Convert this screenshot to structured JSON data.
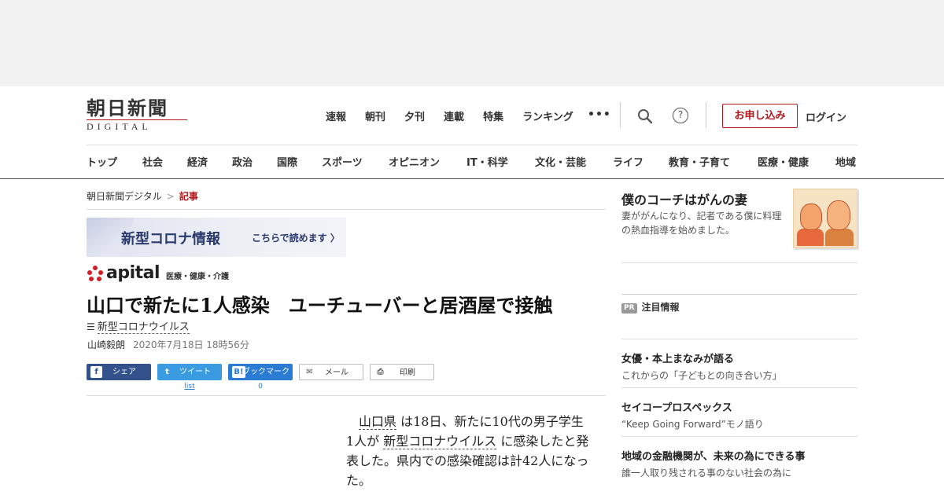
{
  "header": {
    "logo_main": "朝日新聞",
    "logo_sub": "DIGITAL",
    "top_nav": [
      "速報",
      "朝刊",
      "夕刊",
      "連載",
      "特集",
      "ランキング"
    ],
    "more": "•••",
    "help": "?",
    "subscribe_label": "お申し込み",
    "login_label": "ログイン",
    "categories": [
      "トップ",
      "社会",
      "経済",
      "政治",
      "国際",
      "スポーツ",
      "オピニオン",
      "IT・科学",
      "文化・芸能",
      "ライフ",
      "教育・子育て",
      "医療・健康",
      "地域"
    ]
  },
  "breadcrumb": {
    "home": "朝日新聞デジタル",
    "sep": ">",
    "current": "記事"
  },
  "banner": {
    "title": "新型コロナ情報",
    "cta": "こちらで読めます 〉"
  },
  "apital": {
    "word": "apital",
    "tag": "医療・健康・介護"
  },
  "article": {
    "title": "山口で新たに1人感染　ユーチューバーと居酒屋で接触",
    "topic_icon": "☰",
    "topic": "新型コロナウイルス",
    "author": "山崎毅朗",
    "date": "2020年7月18日 18時56分",
    "body_kw1": "山口県",
    "body_p1": " は18日、新たに10代の男子学生1人が ",
    "body_kw2": "新型コロナウイルス",
    "body_p2": " に感染したと発表した。県内での感染確認は計42人になった。"
  },
  "share": {
    "facebook_label": "シェア",
    "facebook_icon": "f",
    "twitter_label": "ツイート",
    "twitter_icon": "t",
    "twitter_count": "list",
    "hatena_label": "ブックマーク",
    "hatena_icon": "B!",
    "hatena_count": "0",
    "mail_label": "メール",
    "mail_icon": "✉",
    "print_label": "印刷",
    "print_icon": "⎙"
  },
  "sidebar": {
    "feature_title": "僕のコーチはがんの妻",
    "feature_desc": "妻ががんになり、記者である僕に料理の熱血指導を始めました。",
    "pr_badge": "PR",
    "pr_heading": "注目情報",
    "promos": [
      {
        "title": "女優・本上まなみが語る",
        "sub": "これからの「子どもとの向き合い方」"
      },
      {
        "title": "セイコープロスペックス",
        "sub": "“Keep Going Forward”モノ語り"
      },
      {
        "title": "地域の金融機関が、未来の為にできる事",
        "sub": "誰一人取り残される事のない社会の為に"
      }
    ]
  },
  "colors": {
    "brand_red": "#b3161b",
    "facebook": "#33518a",
    "twitter": "#3a9be0",
    "hatena": "#2a7bd3"
  }
}
